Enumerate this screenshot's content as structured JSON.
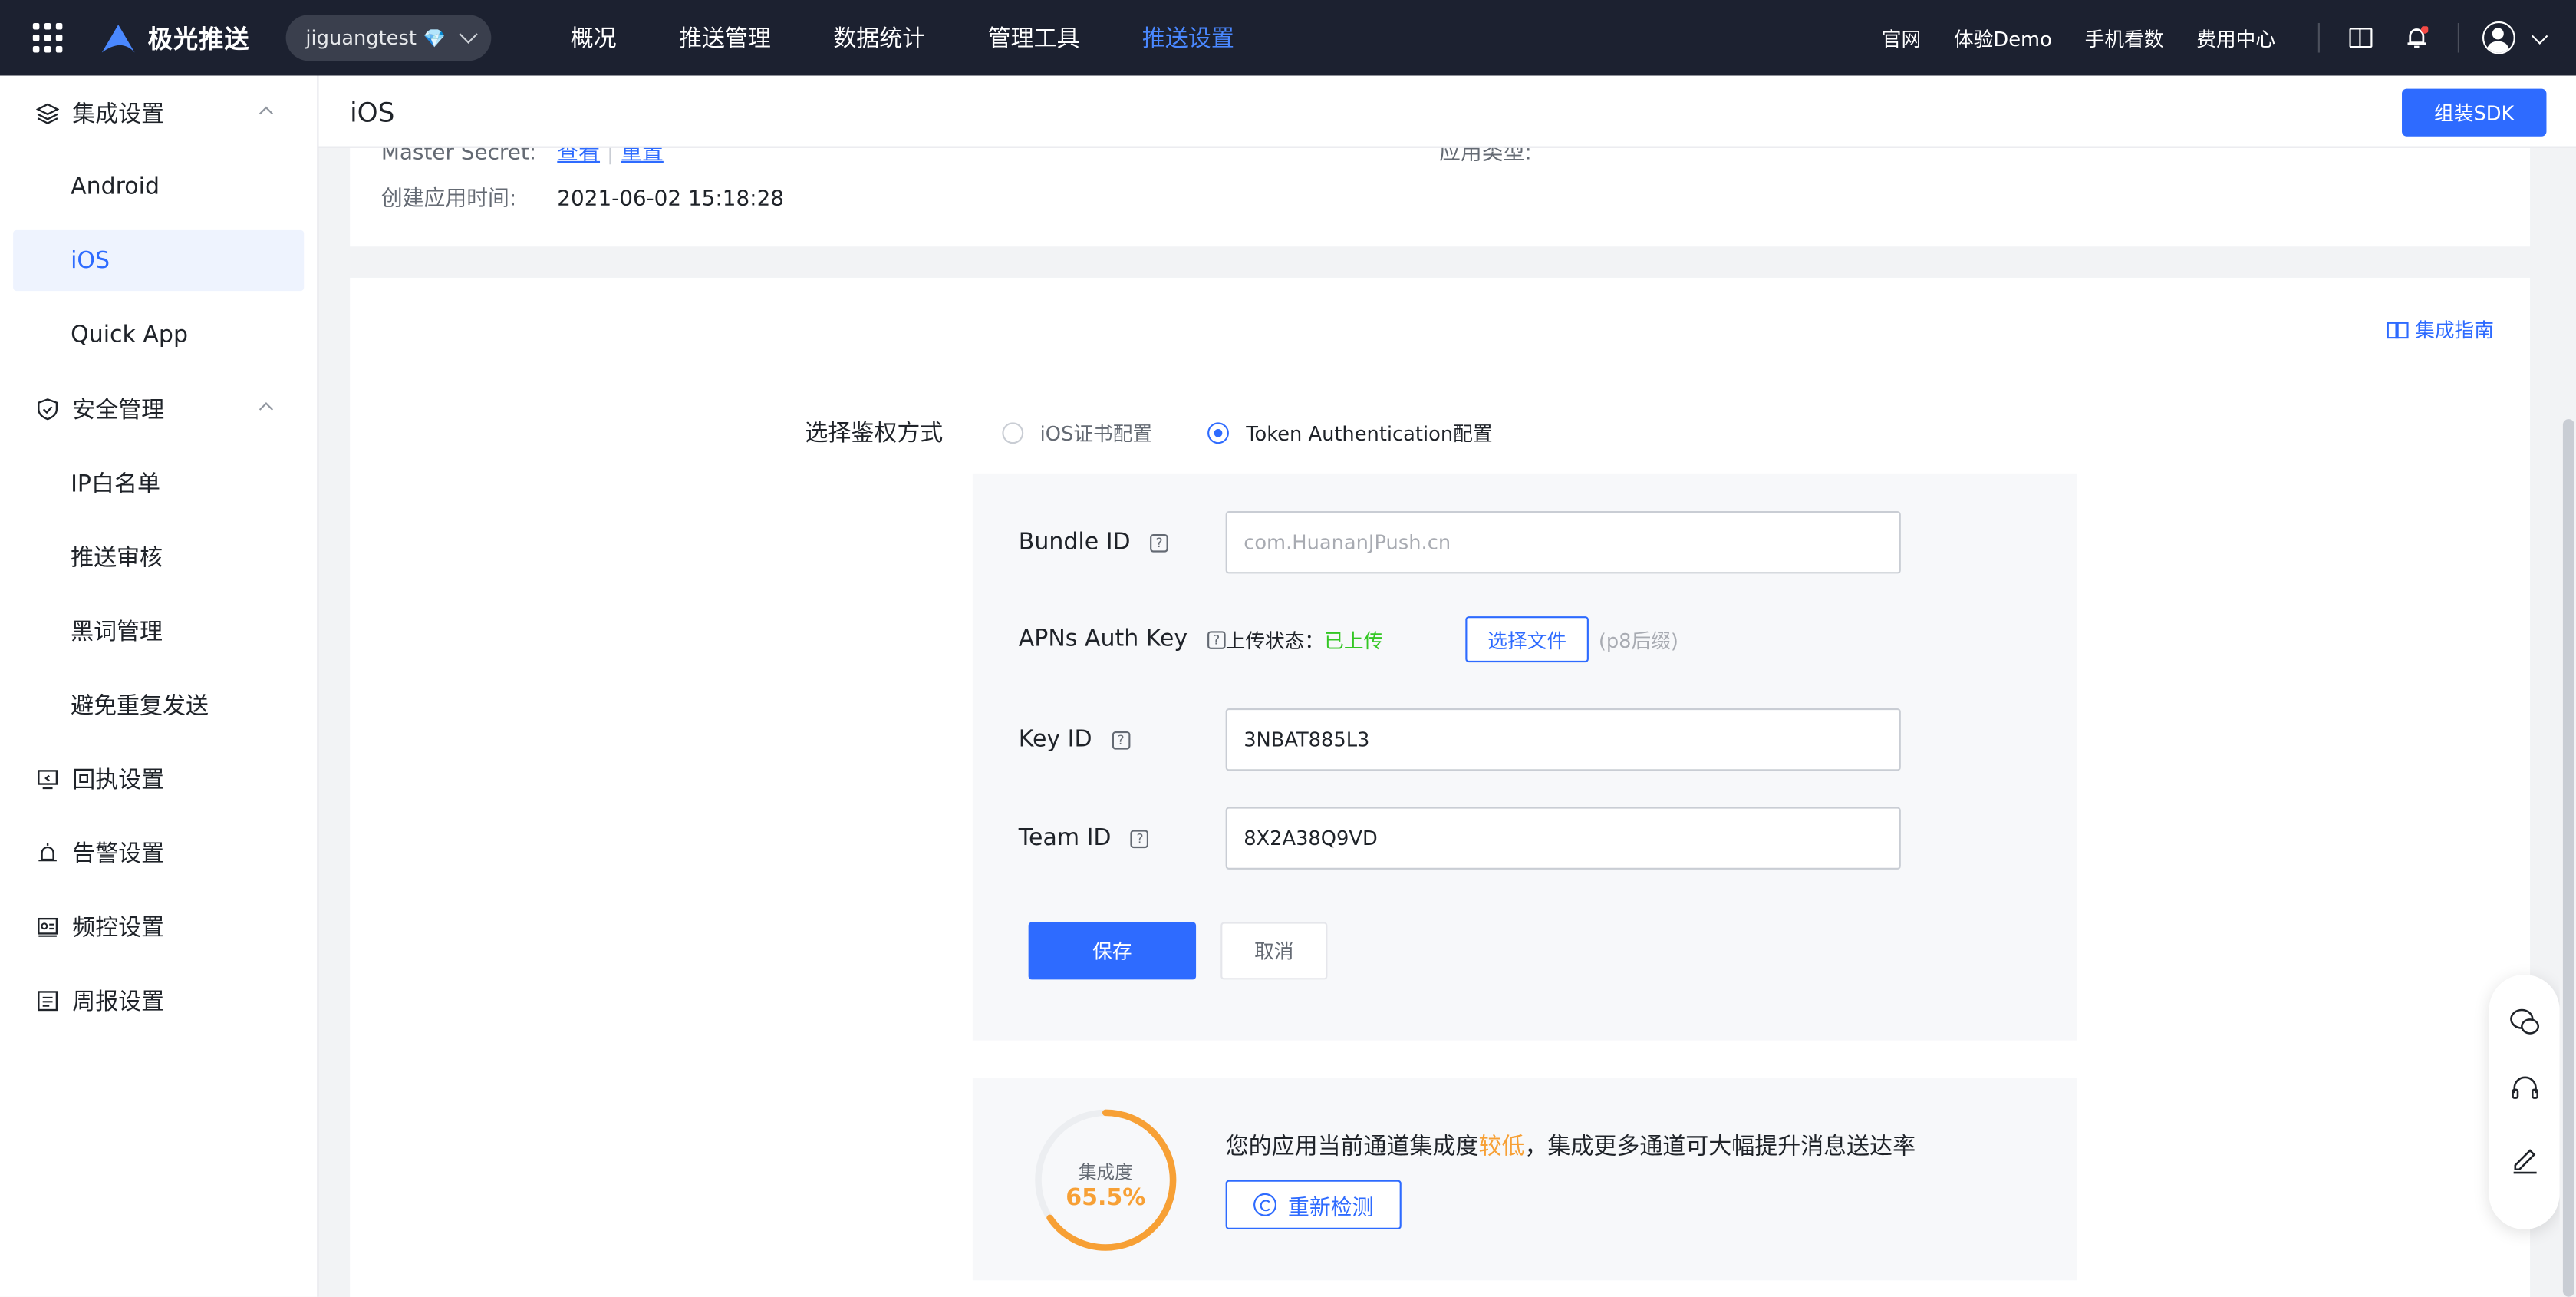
{
  "topbar": {
    "brand": "极光推送",
    "app_name": "jiguangtest",
    "app_badge": "💎",
    "nav": [
      "概况",
      "推送管理",
      "数据统计",
      "管理工具",
      "推送设置"
    ],
    "active_nav": "推送设置",
    "links": [
      "官网",
      "体验Demo",
      "手机看数",
      "费用中心"
    ]
  },
  "sidebar": {
    "group_integration": "集成设置",
    "integration_items": [
      "Android",
      "iOS",
      "Quick App"
    ],
    "active_item": "iOS",
    "group_security": "安全管理",
    "security_items": [
      "IP白名单",
      "推送审核",
      "黑词管理",
      "避免重复发送"
    ],
    "other_groups": [
      "回执设置",
      "告警设置",
      "频控设置",
      "周报设置"
    ]
  },
  "header": {
    "title": "iOS",
    "sdk_button": "组装SDK"
  },
  "app_info": {
    "master_secret_label": "Master Secret:",
    "view_link": "查看",
    "separator": "|",
    "reset_link": "重置",
    "app_type_label": "应用类型:",
    "created_label": "创建应用时间:",
    "created_value": "2021-06-02 15:18:28"
  },
  "config": {
    "guide_link": "集成指南",
    "auth_label": "选择鉴权方式",
    "auth_options": [
      "iOS证书配置",
      "Token Authentication配置"
    ],
    "auth_selected": "Token Authentication配置",
    "bundle_id_label": "Bundle ID",
    "bundle_id_placeholder": "com.HuananJPush.cn",
    "apns_label": "APNs Auth Key",
    "upload_status_label": "上传状态：",
    "upload_status_value": "已上传",
    "choose_file": "选择文件",
    "file_hint": "(p8后缀)",
    "key_id_label": "Key ID",
    "key_id_value": "3NBAT885L3",
    "team_id_label": "Team ID",
    "team_id_value": "8X2A38Q9VD",
    "save_button": "保存",
    "cancel_button": "取消",
    "help_mark": "?"
  },
  "integration_score": {
    "label": "集成度",
    "value_text": "65.5%",
    "value": 65.5,
    "message_prefix": "您的应用当前通道集成度",
    "message_level": "较低",
    "message_suffix": "，集成更多通道可大幅提升消息送达率",
    "recheck_button": "重新检测",
    "color": "#f7a035"
  },
  "colors": {
    "primary": "#2e6bff",
    "topbar_bg": "#1c2130",
    "success": "#34c724",
    "warning": "#f7a035"
  },
  "icons": [
    "apps-grid-icon",
    "jiguang-logo-icon",
    "chevron-down-icon",
    "book-icon",
    "bell-icon",
    "user-avatar-icon",
    "layers-icon",
    "shield-icon",
    "receipt-icon",
    "alarm-icon",
    "frequency-icon",
    "report-icon",
    "wechat-icon",
    "headset-icon",
    "edit-icon",
    "refresh-icon"
  ]
}
